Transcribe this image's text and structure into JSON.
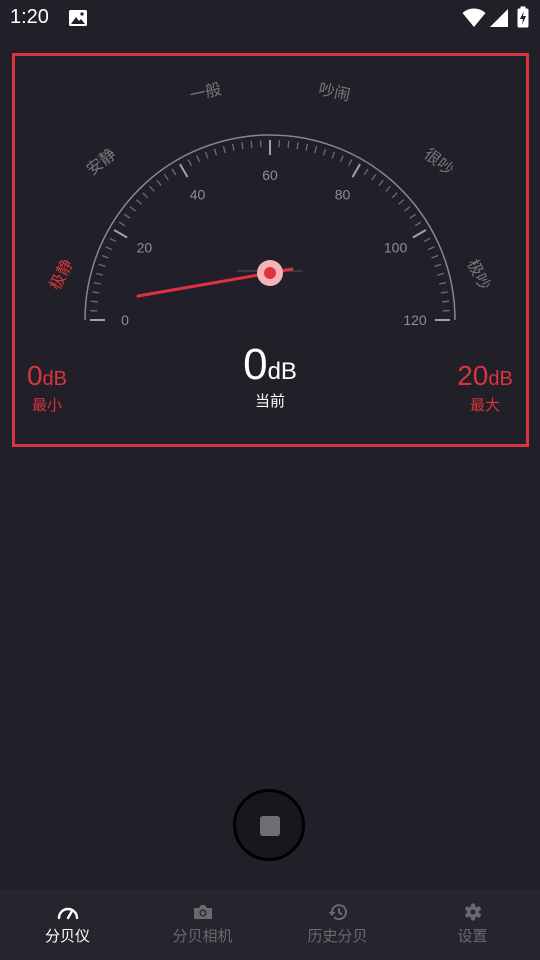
{
  "status_bar": {
    "time": "1:20"
  },
  "gauge": {
    "tick_labels": [
      "0",
      "20",
      "40",
      "60",
      "80",
      "100",
      "120"
    ],
    "zones": [
      "极静",
      "安静",
      "一般",
      "吵闹",
      "很吵",
      "极吵"
    ],
    "needle_value_db": 4,
    "min_db": 0,
    "max_db": 120
  },
  "readings": {
    "min": {
      "value": "0",
      "unit": "dB",
      "label": "最小"
    },
    "current": {
      "value": "0",
      "unit": "dB",
      "label": "当前"
    },
    "max": {
      "value": "20",
      "unit": "dB",
      "label": "最大"
    }
  },
  "nav": {
    "items": [
      {
        "label": "分贝仪",
        "icon": "speedometer-icon",
        "active": true
      },
      {
        "label": "分贝相机",
        "icon": "camera-icon",
        "active": false
      },
      {
        "label": "历史分贝",
        "icon": "history-icon",
        "active": false
      },
      {
        "label": "设置",
        "icon": "gear-icon",
        "active": false
      }
    ]
  },
  "colors": {
    "accent": "#d9343f",
    "background": "#211f27",
    "nav_background": "#26242c",
    "inactive": "#6a6970"
  }
}
